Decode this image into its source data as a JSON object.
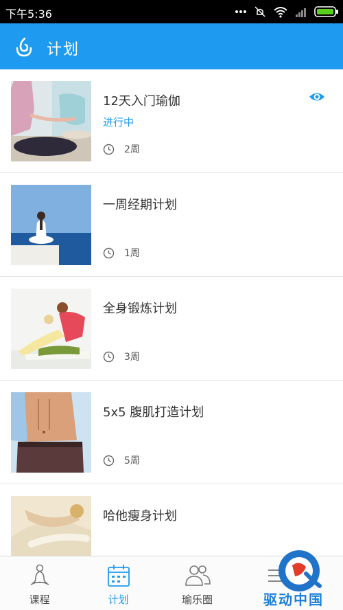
{
  "status_bar": {
    "time": "下午5:36"
  },
  "app_bar": {
    "title": "计划",
    "accent": "#1e9bf0"
  },
  "plans": [
    {
      "title": "12天入门瑜伽",
      "status": "进行中",
      "duration": "2周",
      "thumb": "yoga-meditation-group"
    },
    {
      "title": "一周经期计划",
      "status": "",
      "duration": "1周",
      "thumb": "yoga-sea-meditation"
    },
    {
      "title": "全身锻炼计划",
      "status": "",
      "duration": "3周",
      "thumb": "yoga-stretching-women"
    },
    {
      "title": "5x5 腹肌打造计划",
      "status": "",
      "duration": "5周",
      "thumb": "abs-torso"
    },
    {
      "title": "哈他瘦身计划",
      "status": "",
      "duration": "",
      "thumb": "yoga-backbend"
    }
  ],
  "bottom_nav": [
    {
      "label": "课程",
      "icon": "meditation-person-icon",
      "active": false
    },
    {
      "label": "计划",
      "icon": "calendar-icon",
      "active": true
    },
    {
      "label": "瑜乐圈",
      "icon": "people-icon",
      "active": false
    },
    {
      "label": "",
      "icon": "more-icon",
      "active": false
    }
  ],
  "watermark": {
    "text": "驱动中国"
  }
}
